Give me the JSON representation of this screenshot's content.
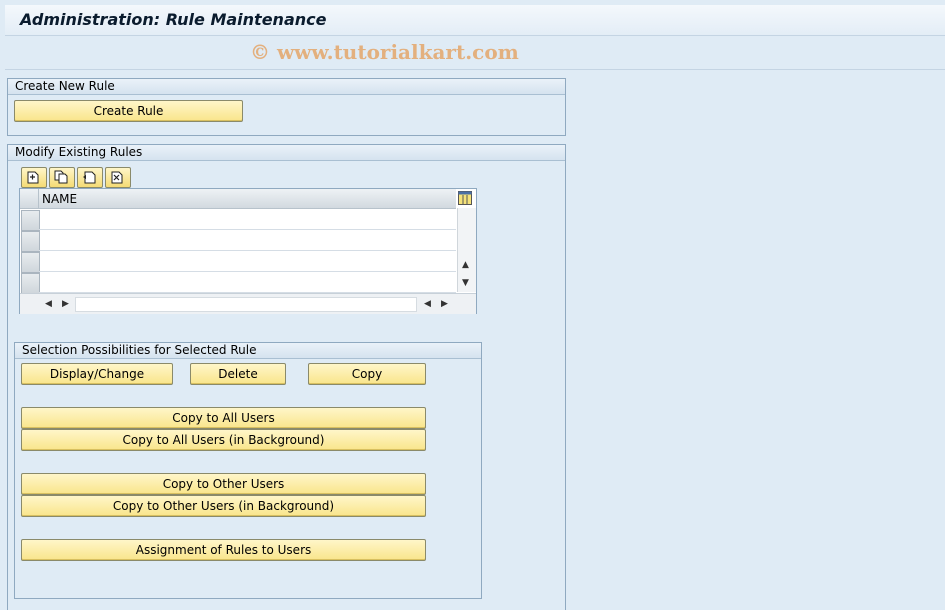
{
  "window": {
    "title": "Administration: Rule Maintenance",
    "watermark": "© www.tutorialkart.com"
  },
  "create_group": {
    "header": "Create New Rule",
    "create_button": "Create Rule"
  },
  "modify_group": {
    "header": "Modify Existing Rules",
    "toolbar_icons": [
      "create-row-icon",
      "copy-row-icon",
      "insert-row-icon",
      "delete-row-icon"
    ],
    "table": {
      "columns": [
        "NAME"
      ],
      "rows": [
        "",
        "",
        "",
        ""
      ]
    }
  },
  "selection_group": {
    "header": "Selection Possibilities for Selected Rule",
    "display_change": "Display/Change",
    "delete": "Delete",
    "copy": "Copy",
    "copy_all": "Copy to All Users",
    "copy_all_bg": "Copy to All Users (in Background)",
    "copy_other": "Copy to Other Users",
    "copy_other_bg": "Copy to Other Users (in Background)",
    "assignment": "Assignment of Rules to Users"
  },
  "colors": {
    "background": "#dfebf5",
    "button": "#f9e58b",
    "border": "#8fa9c0"
  }
}
